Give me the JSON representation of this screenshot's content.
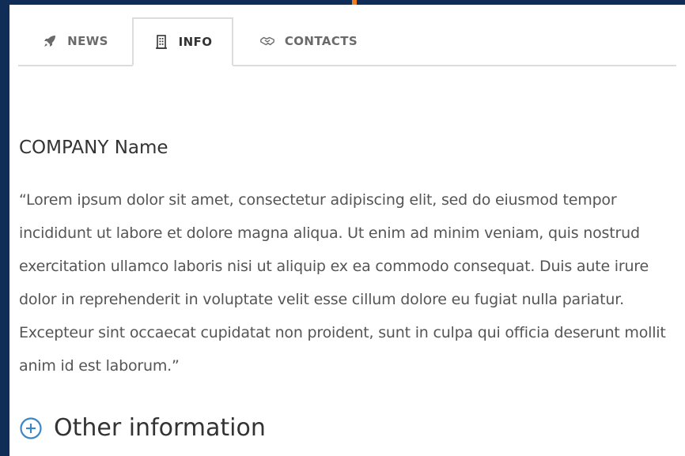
{
  "tabs": [
    {
      "label": "NEWS",
      "icon": "rocket-icon",
      "active": false
    },
    {
      "label": "INFO",
      "icon": "building-icon",
      "active": true
    },
    {
      "label": "CONTACTS",
      "icon": "handshake-icon",
      "active": false
    }
  ],
  "info": {
    "company_name": "COMPANY Name",
    "description": "“Lorem ipsum dolor sit amet, consectetur adipiscing elit, sed do eiusmod tempor incididunt ut labore et dolore magna aliqua. Ut enim ad minim veniam, quis nostrud exercitation ullamco laboris nisi ut aliquip ex ea commodo consequat. Duis aute irure dolor in reprehenderit in voluptate velit esse cillum dolore eu fugiat nulla pariatur. Excepteur sint occaecat cupidatat non proident, sunt in culpa qui officia deserunt mollit anim id est laborum.”"
  },
  "other_info": {
    "label": "Other information",
    "icon": "plus-circle-icon"
  },
  "colors": {
    "background": "#0f2d57",
    "accent": "#f07f1e",
    "panel": "#ffffff",
    "active_text": "#333333",
    "inactive_text": "#6a6a6a",
    "body_text": "#555555",
    "link_blue": "#3b87c6",
    "border": "#dcdcdc"
  }
}
